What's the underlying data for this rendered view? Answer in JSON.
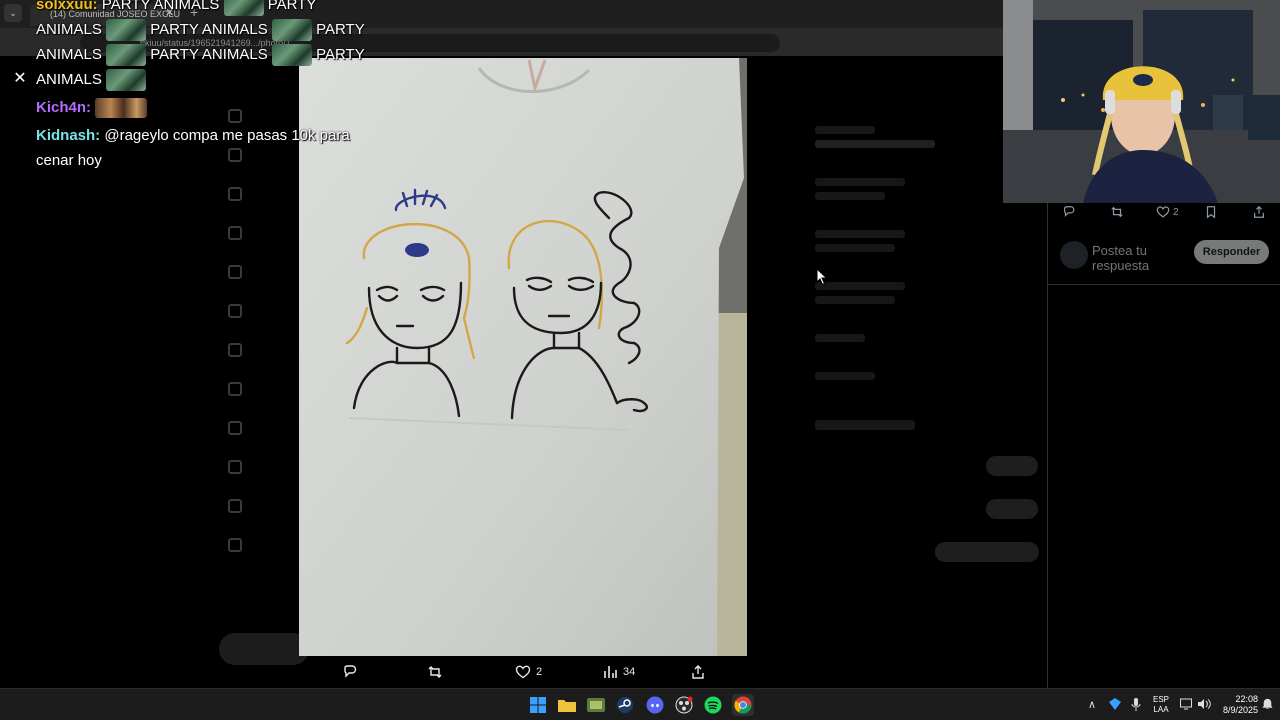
{
  "browser": {
    "tab_title": "(14) Comunidad JOSEO EXCLU...",
    "url": "rikiuu/status/1965219412​69.../photo/1"
  },
  "chat": {
    "line1_user": "solxxuu:",
    "line1_text_a": "PARTY ANIMALS",
    "line1_text_b": "PARTY",
    "line2_a": "ANIMALS",
    "line2_b": "PARTY ANIMALS",
    "line2_c": "PARTY",
    "line3_a": "ANIMALS",
    "line3_b": "PARTY ANIMALS",
    "line3_c": "PARTY",
    "line4_a": "ANIMALS",
    "kich_user": "Kich4n:",
    "kid_user": "Kidnash:",
    "kid_msg_1": "@rageylo compa me pasas 10k para",
    "kid_msg_2": "cenar hoy"
  },
  "viewer_actions": {
    "likes": "2",
    "views": "34"
  },
  "right_panel": {
    "likes": "2",
    "reply_placeholder": "Postea tu respuesta",
    "reply_button": "Responder"
  },
  "taskbar": {
    "lang_1": "ESP",
    "lang_2": "LAA",
    "time": "22:08",
    "date": "8/9/2025"
  },
  "colors": {
    "kich": "#b46bff",
    "kidnash": "#7be2e6",
    "solxxuu": "#f2c01a",
    "reply_button_bg": "#787a7a"
  }
}
